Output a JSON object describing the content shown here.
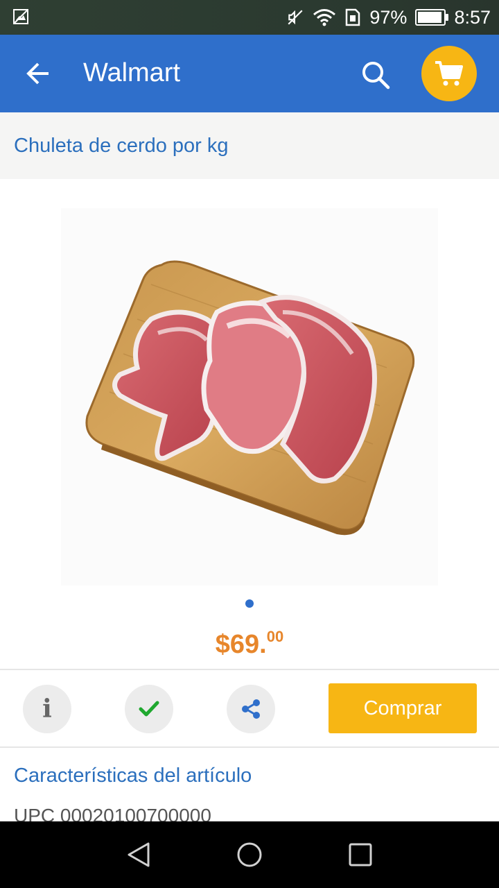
{
  "status_bar": {
    "battery_percent": "97%",
    "time": "8:57",
    "icons": [
      "image-icon",
      "mute-icon",
      "wifi-icon",
      "sim-icon",
      "battery-icon"
    ]
  },
  "appbar": {
    "title": "Walmart",
    "color": "#2f6fcb",
    "cart_color": "#f7b614"
  },
  "product": {
    "title": "Chuleta de cerdo por kg",
    "image": "product-image",
    "price_main": "$69.",
    "price_cents": "00",
    "price_color": "#e7862b"
  },
  "actions": {
    "buy_label": "Comprar",
    "icons": [
      "info-icon",
      "check-icon",
      "share-icon"
    ]
  },
  "details": {
    "section_title": "Características del artículo",
    "upc_text": "UPC  00020100700000"
  },
  "navbar": {
    "icons": [
      "nav-back-icon",
      "nav-home-icon",
      "nav-recent-icon"
    ]
  }
}
